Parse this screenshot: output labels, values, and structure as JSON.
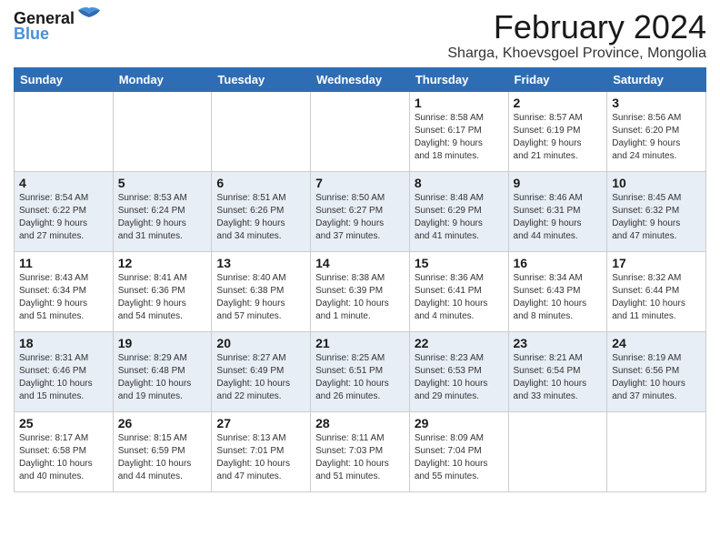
{
  "logo": {
    "text_general": "General",
    "text_blue": "Blue"
  },
  "header": {
    "title": "February 2024",
    "subtitle": "Sharga, Khoevsgoel Province, Mongolia"
  },
  "weekdays": [
    "Sunday",
    "Monday",
    "Tuesday",
    "Wednesday",
    "Thursday",
    "Friday",
    "Saturday"
  ],
  "weeks": [
    [
      {
        "day": "",
        "info": ""
      },
      {
        "day": "",
        "info": ""
      },
      {
        "day": "",
        "info": ""
      },
      {
        "day": "",
        "info": ""
      },
      {
        "day": "1",
        "info": "Sunrise: 8:58 AM\nSunset: 6:17 PM\nDaylight: 9 hours\nand 18 minutes."
      },
      {
        "day": "2",
        "info": "Sunrise: 8:57 AM\nSunset: 6:19 PM\nDaylight: 9 hours\nand 21 minutes."
      },
      {
        "day": "3",
        "info": "Sunrise: 8:56 AM\nSunset: 6:20 PM\nDaylight: 9 hours\nand 24 minutes."
      }
    ],
    [
      {
        "day": "4",
        "info": "Sunrise: 8:54 AM\nSunset: 6:22 PM\nDaylight: 9 hours\nand 27 minutes."
      },
      {
        "day": "5",
        "info": "Sunrise: 8:53 AM\nSunset: 6:24 PM\nDaylight: 9 hours\nand 31 minutes."
      },
      {
        "day": "6",
        "info": "Sunrise: 8:51 AM\nSunset: 6:26 PM\nDaylight: 9 hours\nand 34 minutes."
      },
      {
        "day": "7",
        "info": "Sunrise: 8:50 AM\nSunset: 6:27 PM\nDaylight: 9 hours\nand 37 minutes."
      },
      {
        "day": "8",
        "info": "Sunrise: 8:48 AM\nSunset: 6:29 PM\nDaylight: 9 hours\nand 41 minutes."
      },
      {
        "day": "9",
        "info": "Sunrise: 8:46 AM\nSunset: 6:31 PM\nDaylight: 9 hours\nand 44 minutes."
      },
      {
        "day": "10",
        "info": "Sunrise: 8:45 AM\nSunset: 6:32 PM\nDaylight: 9 hours\nand 47 minutes."
      }
    ],
    [
      {
        "day": "11",
        "info": "Sunrise: 8:43 AM\nSunset: 6:34 PM\nDaylight: 9 hours\nand 51 minutes."
      },
      {
        "day": "12",
        "info": "Sunrise: 8:41 AM\nSunset: 6:36 PM\nDaylight: 9 hours\nand 54 minutes."
      },
      {
        "day": "13",
        "info": "Sunrise: 8:40 AM\nSunset: 6:38 PM\nDaylight: 9 hours\nand 57 minutes."
      },
      {
        "day": "14",
        "info": "Sunrise: 8:38 AM\nSunset: 6:39 PM\nDaylight: 10 hours\nand 1 minute."
      },
      {
        "day": "15",
        "info": "Sunrise: 8:36 AM\nSunset: 6:41 PM\nDaylight: 10 hours\nand 4 minutes."
      },
      {
        "day": "16",
        "info": "Sunrise: 8:34 AM\nSunset: 6:43 PM\nDaylight: 10 hours\nand 8 minutes."
      },
      {
        "day": "17",
        "info": "Sunrise: 8:32 AM\nSunset: 6:44 PM\nDaylight: 10 hours\nand 11 minutes."
      }
    ],
    [
      {
        "day": "18",
        "info": "Sunrise: 8:31 AM\nSunset: 6:46 PM\nDaylight: 10 hours\nand 15 minutes."
      },
      {
        "day": "19",
        "info": "Sunrise: 8:29 AM\nSunset: 6:48 PM\nDaylight: 10 hours\nand 19 minutes."
      },
      {
        "day": "20",
        "info": "Sunrise: 8:27 AM\nSunset: 6:49 PM\nDaylight: 10 hours\nand 22 minutes."
      },
      {
        "day": "21",
        "info": "Sunrise: 8:25 AM\nSunset: 6:51 PM\nDaylight: 10 hours\nand 26 minutes."
      },
      {
        "day": "22",
        "info": "Sunrise: 8:23 AM\nSunset: 6:53 PM\nDaylight: 10 hours\nand 29 minutes."
      },
      {
        "day": "23",
        "info": "Sunrise: 8:21 AM\nSunset: 6:54 PM\nDaylight: 10 hours\nand 33 minutes."
      },
      {
        "day": "24",
        "info": "Sunrise: 8:19 AM\nSunset: 6:56 PM\nDaylight: 10 hours\nand 37 minutes."
      }
    ],
    [
      {
        "day": "25",
        "info": "Sunrise: 8:17 AM\nSunset: 6:58 PM\nDaylight: 10 hours\nand 40 minutes."
      },
      {
        "day": "26",
        "info": "Sunrise: 8:15 AM\nSunset: 6:59 PM\nDaylight: 10 hours\nand 44 minutes."
      },
      {
        "day": "27",
        "info": "Sunrise: 8:13 AM\nSunset: 7:01 PM\nDaylight: 10 hours\nand 47 minutes."
      },
      {
        "day": "28",
        "info": "Sunrise: 8:11 AM\nSunset: 7:03 PM\nDaylight: 10 hours\nand 51 minutes."
      },
      {
        "day": "29",
        "info": "Sunrise: 8:09 AM\nSunset: 7:04 PM\nDaylight: 10 hours\nand 55 minutes."
      },
      {
        "day": "",
        "info": ""
      },
      {
        "day": "",
        "info": ""
      }
    ]
  ]
}
